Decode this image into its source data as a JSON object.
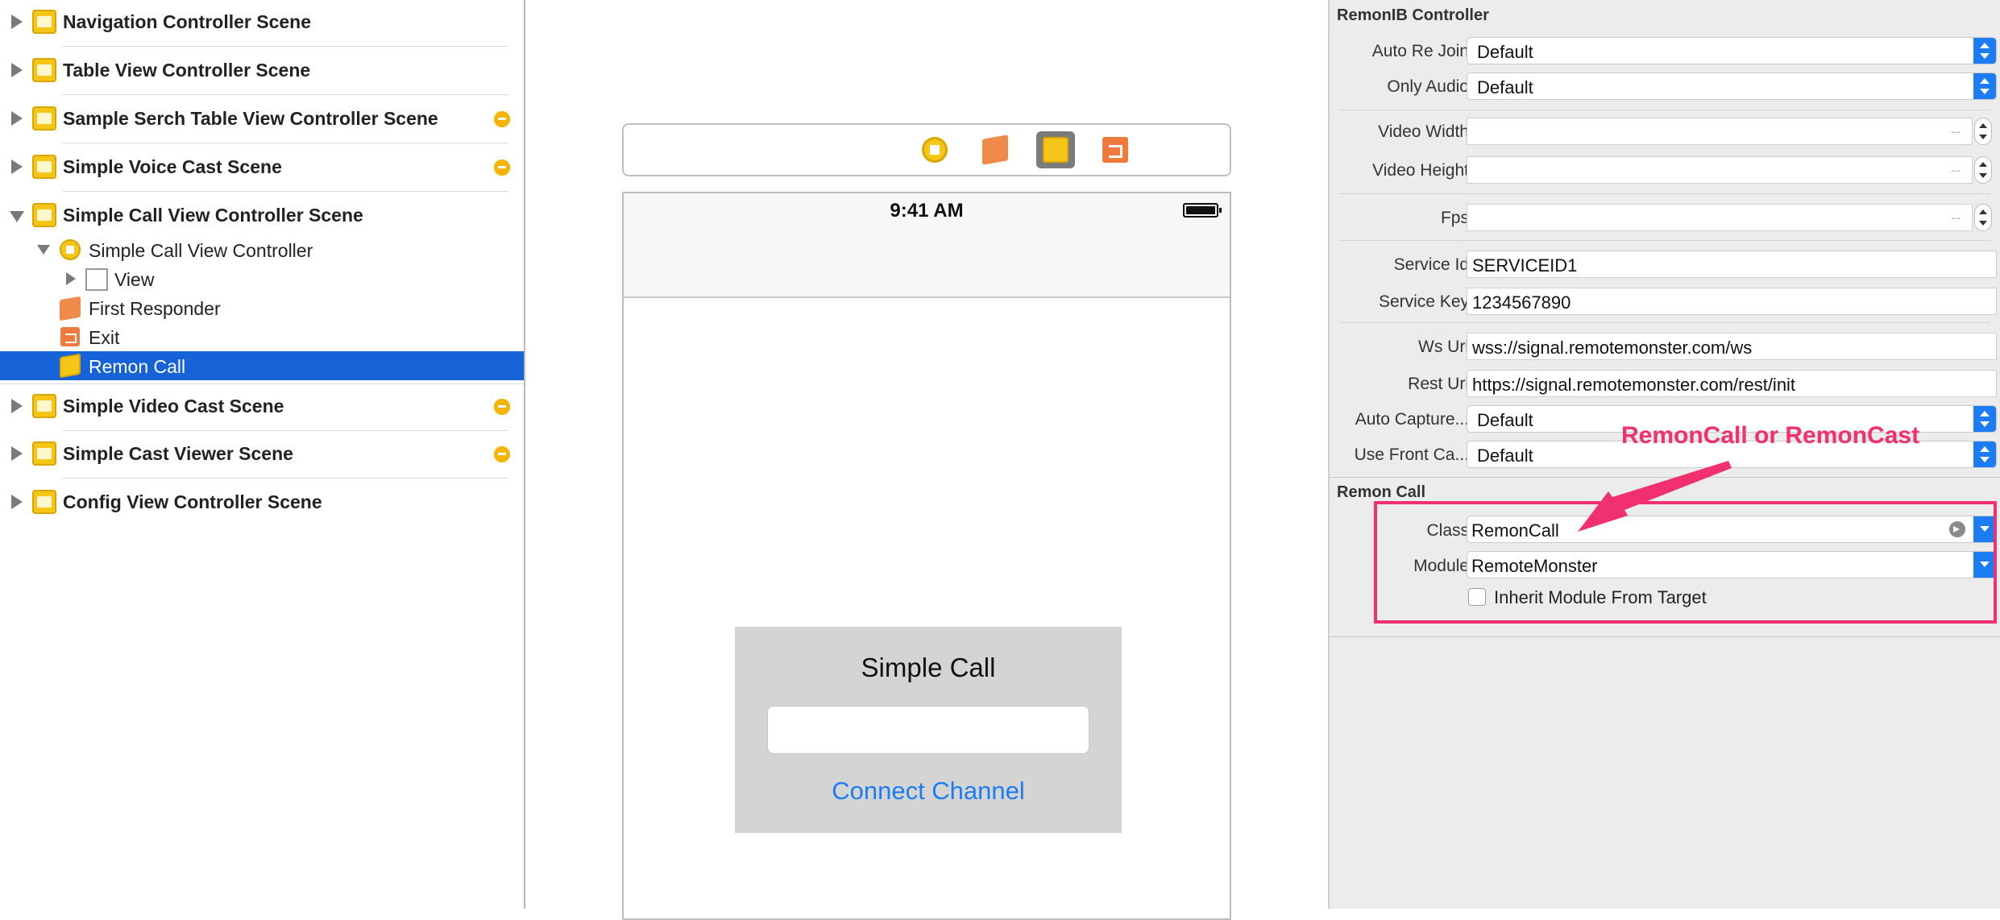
{
  "navigator": {
    "scenes": [
      {
        "label": "Navigation Controller Scene",
        "segue": false,
        "expanded": false
      },
      {
        "label": "Table View Controller Scene",
        "segue": false,
        "expanded": false
      },
      {
        "label": "Sample Serch Table View Controller Scene",
        "segue": true,
        "expanded": false
      },
      {
        "label": "Simple Voice Cast Scene",
        "segue": true,
        "expanded": false
      },
      {
        "label": "Simple Call View Controller Scene",
        "segue": false,
        "expanded": true
      },
      {
        "label": "Simple Video Cast Scene",
        "segue": true,
        "expanded": false
      },
      {
        "label": "Simple Cast Viewer Scene",
        "segue": true,
        "expanded": false
      },
      {
        "label": "Config View Controller Scene",
        "segue": false,
        "expanded": false
      }
    ],
    "children": {
      "view_controller": "Simple Call View Controller",
      "view": "View",
      "first_responder": "First Responder",
      "exit": "Exit",
      "remon_call": "Remon Call"
    }
  },
  "canvas": {
    "status_time": "9:41 AM",
    "panel_title": "Simple Call",
    "channel_input_value": "",
    "connect_button": "Connect Channel"
  },
  "inspector": {
    "section1_title": "RemonIB Controller",
    "auto_re_join": {
      "label": "Auto Re Join",
      "value": "Default"
    },
    "only_audio": {
      "label": "Only Audio",
      "value": "Default"
    },
    "video_width": {
      "label": "Video Width",
      "placeholder": "--"
    },
    "video_height": {
      "label": "Video Height",
      "placeholder": "--"
    },
    "fps": {
      "label": "Fps",
      "placeholder": "--"
    },
    "service_id": {
      "label": "Service Id",
      "value": "SERVICEID1"
    },
    "service_key": {
      "label": "Service Key",
      "value": "1234567890"
    },
    "ws_url": {
      "label": "Ws Url",
      "value": "wss://signal.remotemonster.com/ws"
    },
    "rest_url": {
      "label": "Rest Url",
      "value": "https://signal.remotemonster.com/rest/init"
    },
    "auto_capture": {
      "label": "Auto Capture...",
      "value": "Default"
    },
    "use_front_ca": {
      "label": "Use Front Ca...",
      "value": "Default"
    },
    "section2_title": "Remon Call",
    "class": {
      "label": "Class",
      "value": "RemonCall"
    },
    "module": {
      "label": "Module",
      "value": "RemoteMonster"
    },
    "inherit_label": "Inherit Module From Target",
    "inherit_checked": false
  },
  "annotation": {
    "text": "RemonCall or RemonCast",
    "color": "#f0306f"
  },
  "colors": {
    "selection": "#1563d6",
    "link_blue": "#1b7cf5",
    "scene_yellow": "#f5c518",
    "orange": "#f08a4b"
  }
}
